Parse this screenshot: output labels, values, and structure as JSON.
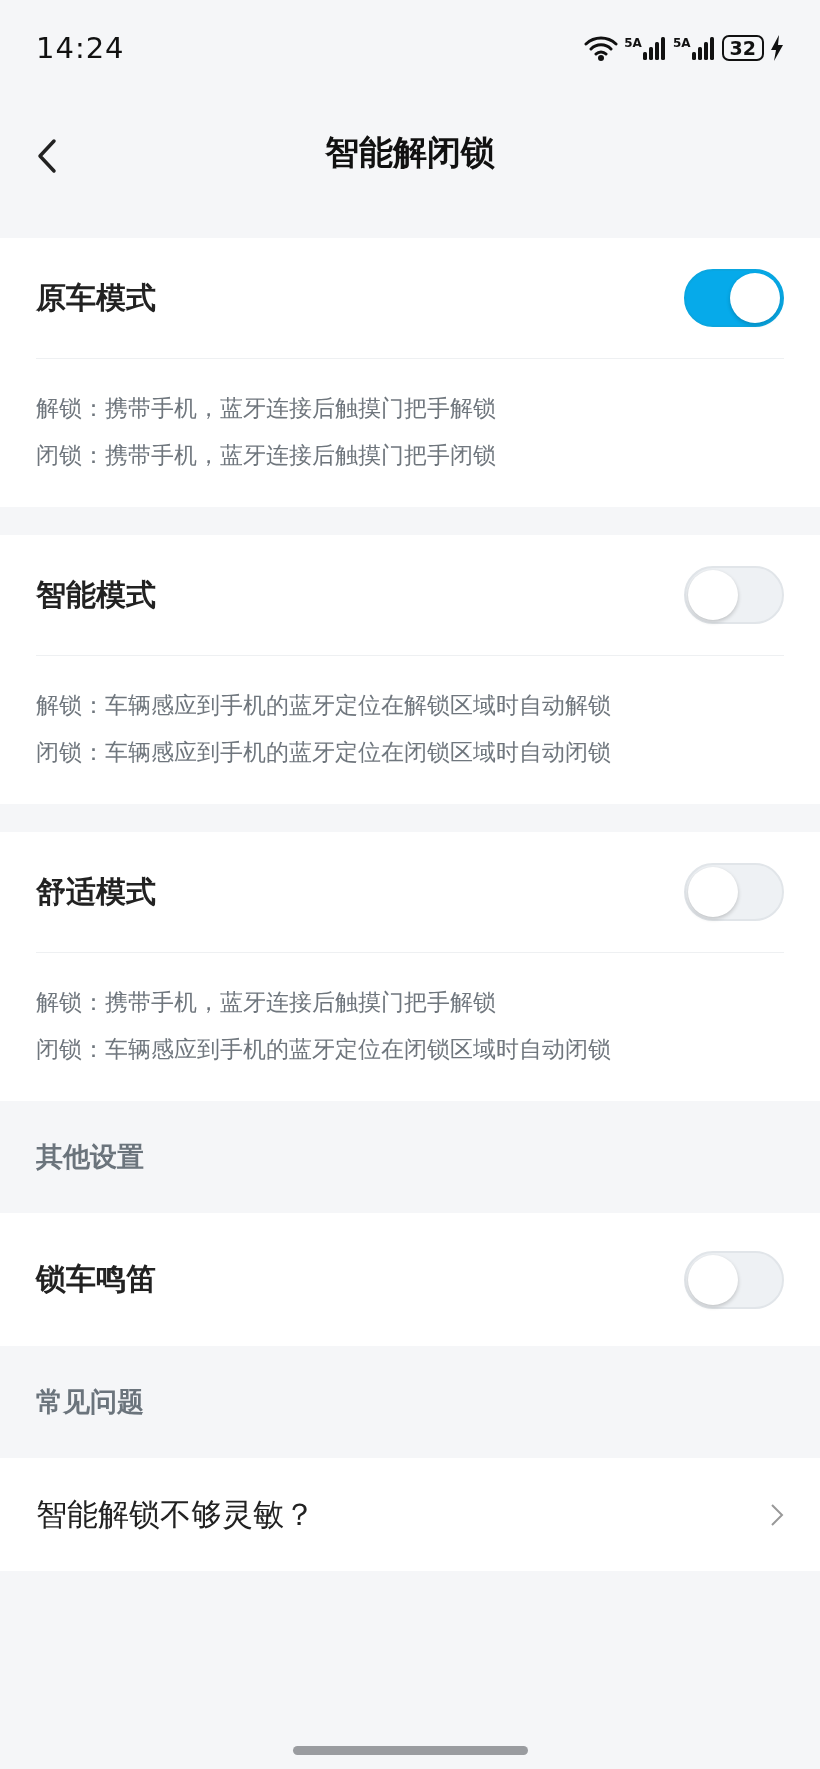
{
  "status_bar": {
    "time": "14:24",
    "network_labels": [
      "5A",
      "5A"
    ],
    "battery": "32",
    "charging": true
  },
  "header": {
    "title": "智能解闭锁"
  },
  "modes": [
    {
      "title": "原车模式",
      "on": true,
      "lines": [
        "解锁：携带手机，蓝牙连接后触摸门把手解锁",
        "闭锁：携带手机，蓝牙连接后触摸门把手闭锁"
      ]
    },
    {
      "title": "智能模式",
      "on": false,
      "lines": [
        "解锁：车辆感应到手机的蓝牙定位在解锁区域时自动解锁",
        "闭锁：车辆感应到手机的蓝牙定位在闭锁区域时自动闭锁"
      ]
    },
    {
      "title": "舒适模式",
      "on": false,
      "lines": [
        "解锁：携带手机，蓝牙连接后触摸门把手解锁",
        "闭锁：车辆感应到手机的蓝牙定位在闭锁区域时自动闭锁"
      ]
    }
  ],
  "sections": [
    {
      "heading": "其他设置",
      "items": [
        {
          "kind": "toggle",
          "label": "锁车鸣笛",
          "on": false
        }
      ]
    },
    {
      "heading": "常见问题",
      "items": [
        {
          "kind": "link",
          "label": "智能解锁不够灵敏？"
        }
      ]
    }
  ]
}
